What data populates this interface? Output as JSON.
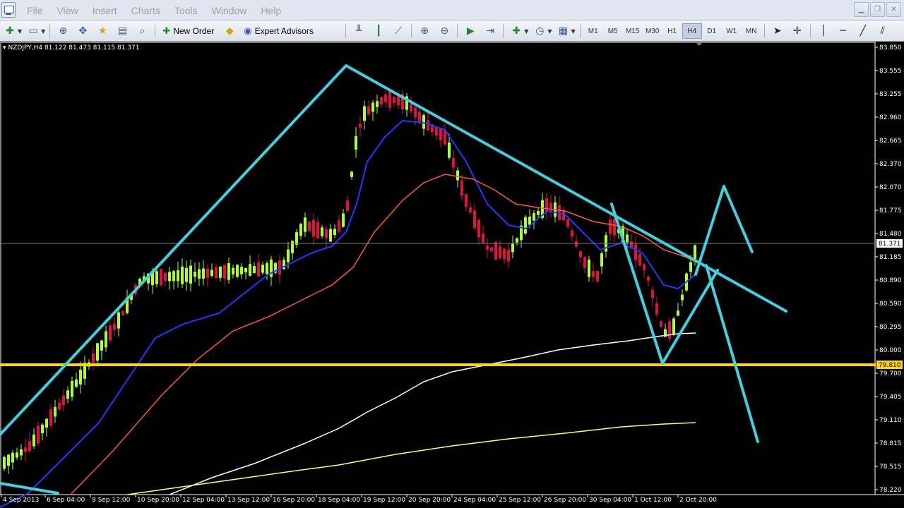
{
  "menu": {
    "items": [
      "File",
      "View",
      "Insert",
      "Charts",
      "Tools",
      "Window",
      "Help"
    ]
  },
  "window_controls": {
    "minimize": "▁",
    "restore": "❐",
    "close": "✕"
  },
  "toolbar": {
    "new_order_label": "New Order",
    "expert_advisors_label": "Expert Advisors",
    "timeframes": [
      "M1",
      "M5",
      "M15",
      "M30",
      "H1",
      "H4",
      "D1",
      "W1",
      "MN"
    ],
    "active_timeframe": "H4"
  },
  "chart": {
    "header": "NZDJPY,H4  81.122 81.473 81.115 81.371",
    "price_labels": [
      "83.850",
      "83.555",
      "83.255",
      "82.960",
      "82.665",
      "82.370",
      "82.070",
      "81.775",
      "81.480",
      "81.185",
      "80.890",
      "80.590",
      "80.295",
      "80.000",
      "79.700",
      "79.405",
      "79.110",
      "78.815",
      "78.515",
      "78.220"
    ],
    "time_labels": [
      "4 Sep 2013",
      "6 Sep 04:00",
      "9 Sep 12:00",
      "10 Sep 20:00",
      "12 Sep 04:00",
      "13 Sep 12:00",
      "16 Sep 20:00",
      "18 Sep 04:00",
      "19 Sep 12:00",
      "20 Sep 20:00",
      "24 Sep 04:00",
      "25 Sep 12:00",
      "26 Sep 20:00",
      "30 Sep 04:00",
      "1 Oct 12:00",
      "2 Oct 20:00"
    ],
    "current_price": "81.371",
    "horizontal_level": "79.810",
    "colors": {
      "background": "#000000",
      "bull_candle": "#adff2f",
      "bear_candle": "#dc143c",
      "trendline": "#40d0e0",
      "level_line": "#ffd700",
      "ma_blue": "#1e3cff",
      "ma_orange": "#ff5a2a",
      "ma_white": "#ffffff",
      "ma_yellow": "#ffff66"
    }
  }
}
